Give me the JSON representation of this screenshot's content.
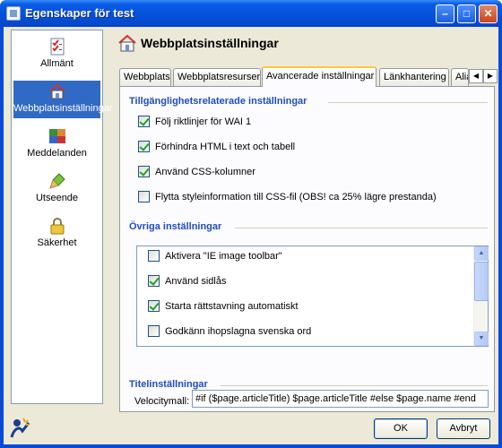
{
  "window": {
    "title": "Egenskaper för test"
  },
  "sidebar": {
    "items": [
      {
        "label": "Allmänt",
        "icon": "checklist-icon"
      },
      {
        "label": "Webbplatsinställningar",
        "icon": "house-icon"
      },
      {
        "label": "Meddelanden",
        "icon": "messages-icon"
      },
      {
        "label": "Utseende",
        "icon": "paintbrush-icon"
      },
      {
        "label": "Säkerhet",
        "icon": "lock-icon"
      }
    ],
    "selected": "Webbplatsinställningar"
  },
  "header": {
    "title": "Webbplatsinställningar"
  },
  "tabs": [
    "Webbplats",
    "Webbplatsresurser",
    "Avancerade inställningar",
    "Länkhantering",
    "Alia"
  ],
  "selected_tab": "Avancerade inställningar",
  "accessibility": {
    "heading": "Tillgänglighetsrelaterade inställningar",
    "options": [
      {
        "label": "Följ riktlinjer för WAI 1",
        "checked": true
      },
      {
        "label": "Förhindra HTML i text och tabell",
        "checked": true
      },
      {
        "label": "Använd CSS-kolumner",
        "checked": true
      },
      {
        "label": "Flytta styleinformation till CSS-fil (OBS! ca 25% lägre prestanda)",
        "checked": false
      }
    ]
  },
  "other": {
    "heading": "Övriga inställningar",
    "options": [
      {
        "label": "Aktivera \"IE image toolbar\"",
        "checked": false
      },
      {
        "label": "Använd sidlås",
        "checked": true
      },
      {
        "label": "Starta rättstavning automatiskt",
        "checked": true
      },
      {
        "label": "Godkänn ihopslagna svenska ord",
        "checked": false
      }
    ]
  },
  "title_settings": {
    "heading": "Titelinställningar",
    "velocity_label": "Velocitymall:",
    "velocity_value": "#if ($page.articleTitle) $page.articleTitle #else $page.name #end"
  },
  "buttons": {
    "ok": "OK",
    "cancel": "Avbryt"
  }
}
